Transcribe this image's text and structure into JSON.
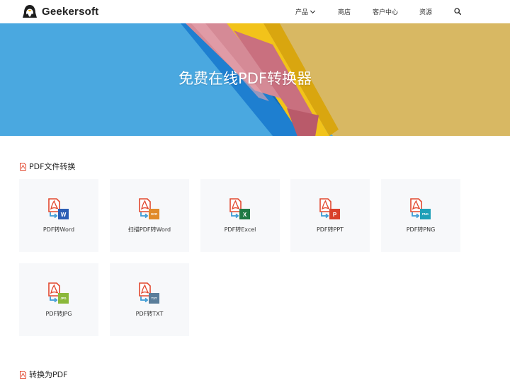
{
  "header": {
    "brand": "Geekersoft",
    "nav": [
      {
        "label": "产品"
      },
      {
        "label": "商店"
      },
      {
        "label": "客户中心"
      },
      {
        "label": "资源"
      }
    ]
  },
  "banner": {
    "title": "免费在线PDF转换器"
  },
  "sections": [
    {
      "title": "PDF文件转换",
      "cards": [
        {
          "label": "PDF转Word",
          "badge": "W",
          "badge_color": "#2b5eb5"
        },
        {
          "label": "扫描PDF转Word",
          "badge": "OCR",
          "badge_color": "#e08a2a"
        },
        {
          "label": "PDF转Excel",
          "badge": "X",
          "badge_color": "#1f7a45"
        },
        {
          "label": "PDF转PPT",
          "badge": "P",
          "badge_color": "#d9402b"
        },
        {
          "label": "PDF转PNG",
          "badge": "PNG",
          "badge_color": "#1ea0b8"
        },
        {
          "label": "PDF转JPG",
          "badge": "JPG",
          "badge_color": "#8bb83a"
        },
        {
          "label": "PDF转TXT",
          "badge": "TXT",
          "badge_color": "#5a7d9a"
        }
      ]
    },
    {
      "title": "转换为PDF"
    }
  ],
  "colors": {
    "pdf_red": "#e2482f",
    "arrow_blue": "#3a9bd6",
    "card_bg": "#f7f8fa"
  }
}
